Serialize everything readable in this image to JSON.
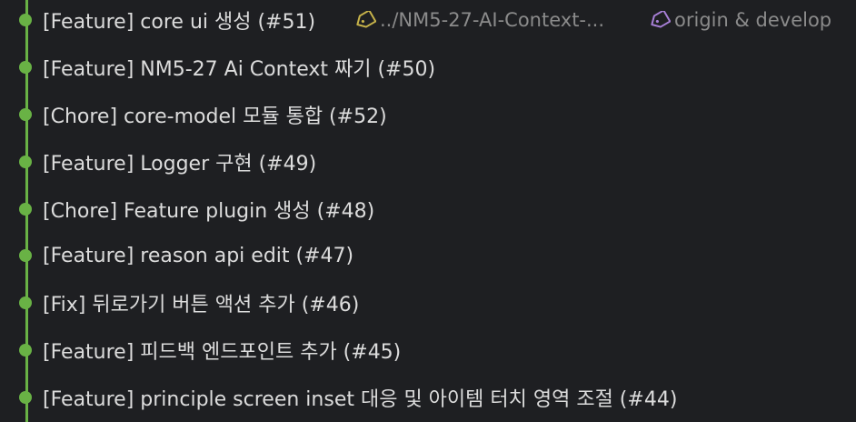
{
  "graph": {
    "line_color": "#69b245",
    "dot_color": "#69b245"
  },
  "commits": [
    {
      "message": "[Feature]  core ui 생성 (#51)",
      "refs": [
        {
          "label": "../NM5-27-AI-Context-...",
          "icon": "tag-icon",
          "icon_color": "#c7b34a"
        },
        {
          "label": "origin & develop",
          "icon": "tag-icon",
          "icon_color": "#a77fd6"
        }
      ]
    },
    {
      "message": "[Feature] NM5-27 Ai Context 짜기 (#50)"
    },
    {
      "message": "[Chore] core-model 모듈 통합 (#52)"
    },
    {
      "message": "[Feature] Logger 구현 (#49)"
    },
    {
      "message": "[Chore] Feature plugin 생성 (#48)"
    },
    {
      "message": "[Feature] reason api edit (#47)"
    },
    {
      "message": "[Fix] 뒤로가기 버튼 액션 추가 (#46)"
    },
    {
      "message": "[Feature] 피드백 엔드포인트 추가 (#45)"
    },
    {
      "message": "[Feature] principle screen inset 대응 및 아이템 터치 영역 조절 (#44)"
    }
  ]
}
